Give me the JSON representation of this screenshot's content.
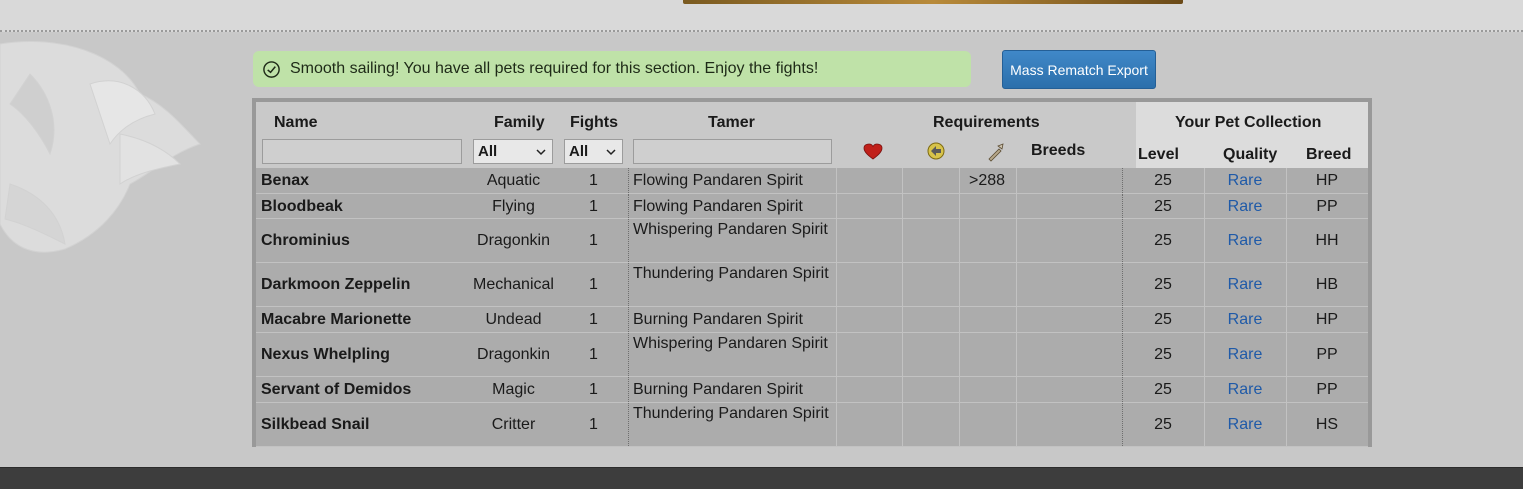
{
  "notice": {
    "text": "Smooth sailing! You have all pets required for this section. Enjoy the fights!"
  },
  "export_button": "Mass Rematch Export",
  "table": {
    "headers": {
      "name": "Name",
      "family": "Family",
      "fights": "Fights",
      "tamer": "Tamer",
      "requirements": "Requirements",
      "breeds": "Breeds",
      "collection": "Your Pet Collection",
      "level": "Level",
      "quality": "Quality",
      "breed": "Breed"
    },
    "filters": {
      "name_value": "",
      "family_selected": "All",
      "fights_selected": "All",
      "tamer_value": ""
    },
    "requirement_icons": [
      "heart-icon",
      "speed-icon",
      "power-icon"
    ],
    "rows": [
      {
        "name": "Benax",
        "family": "Aquatic",
        "fights": "1",
        "tamer": "Flowing Pandaren Spirit",
        "req_speed": ">288",
        "level": "25",
        "quality": "Rare",
        "breed": "HP"
      },
      {
        "name": "Bloodbeak",
        "family": "Flying",
        "fights": "1",
        "tamer": "Flowing Pandaren Spirit",
        "req_speed": "",
        "level": "25",
        "quality": "Rare",
        "breed": "PP"
      },
      {
        "name": "Chrominius",
        "family": "Dragonkin",
        "fights": "1",
        "tamer": "Whispering Pandaren Spirit",
        "req_speed": "",
        "level": "25",
        "quality": "Rare",
        "breed": "HH"
      },
      {
        "name": "Darkmoon Zeppelin",
        "family": "Mechanical",
        "fights": "1",
        "tamer": "Thundering Pandaren Spirit",
        "req_speed": "",
        "level": "25",
        "quality": "Rare",
        "breed": "HB"
      },
      {
        "name": "Macabre Marionette",
        "family": "Undead",
        "fights": "1",
        "tamer": "Burning Pandaren Spirit",
        "req_speed": "",
        "level": "25",
        "quality": "Rare",
        "breed": "HP"
      },
      {
        "name": "Nexus Whelpling",
        "family": "Dragonkin",
        "fights": "1",
        "tamer": "Whispering Pandaren Spirit",
        "req_speed": "",
        "level": "25",
        "quality": "Rare",
        "breed": "PP"
      },
      {
        "name": "Servant of Demidos",
        "family": "Magic",
        "fights": "1",
        "tamer": "Burning Pandaren Spirit",
        "req_speed": "",
        "level": "25",
        "quality": "Rare",
        "breed": "PP"
      },
      {
        "name": "Silkbead Snail",
        "family": "Critter",
        "fights": "1",
        "tamer": "Thundering Pandaren Spirit",
        "req_speed": "",
        "level": "25",
        "quality": "Rare",
        "breed": "HS"
      }
    ]
  },
  "colors": {
    "notice_bg": "#bfe2a8",
    "button_bg": "#2f77b8",
    "rare_link": "#1f5aa8",
    "footer": "#3d3d3d"
  }
}
